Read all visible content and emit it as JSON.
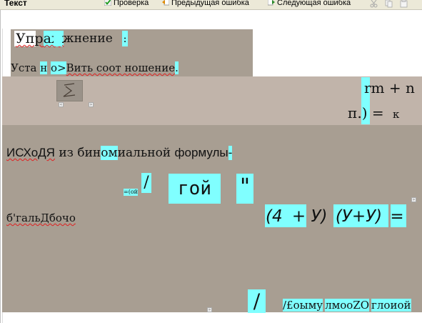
{
  "toolbar": {
    "title": "Текст",
    "check_label": "Проверка",
    "prev_error_label": "Предыдущая ошибка",
    "next_error_label": "Следующая ошибка"
  },
  "document": {
    "exercise_a": "Упр",
    "exercise_b": "аж",
    "exercise_c": "жнение",
    "exercise_d": ":",
    "line2_a": "Уста",
    "line2_b": "н",
    "line2_c": "о",
    "line2_d": ">",
    "line2_e": "Вить соот ношение",
    "line2_f": ".",
    "formula_rm": "rm + n",
    "formula_p": "п.",
    "formula_paren": ")",
    "formula_eq": "=",
    "formula_k": "к",
    "left_mark_1": "«",
    "left_mark_2": "»",
    "iskhodya_a": "ИСХоДЯ",
    "iskhodya_b": " из бин",
    "iskhodya_c": "ом",
    "iskhodya_d": "иальной ",
    "iskhodya_e": "формулы",
    "iskhodya_f": "-",
    "slash_1": "/",
    "koy_small": "=(ой",
    "goy": "гой",
    "quote": "\"",
    "bgal": "б'гальДбочо",
    "expr_1": "(4",
    "expr_2": "+",
    "expr_3": "У)",
    "expr_4": "(У+У)",
    "expr_5": "=",
    "slash_2": "/",
    "bottom_1": "/£оыму",
    "bottom_2": "лмооZО",
    "bottom_3": "глоиой",
    "right_marker": "»",
    "bottom_marker": "»"
  },
  "colors": {
    "highlight": "#80ffff",
    "band_dark": "#a89e92",
    "band_light": "#c1b4aa",
    "spell_error": "#e02020"
  }
}
